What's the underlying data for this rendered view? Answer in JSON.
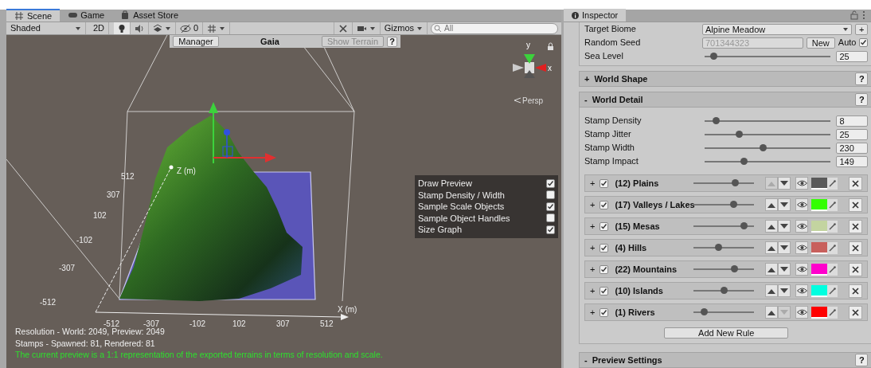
{
  "scene_tabs": [
    {
      "label": "Scene",
      "selected": true
    },
    {
      "label": "Game",
      "selected": false
    },
    {
      "label": "Asset Store",
      "selected": false
    }
  ],
  "scene_toolbar": {
    "shading": "Shaded",
    "mode_2d": "2D",
    "hidden_count": "0",
    "gizmos": "Gizmos",
    "search_placeholder": "All"
  },
  "gaia_bar": {
    "manager": "Manager",
    "title": "Gaia",
    "show_terrain": "Show Terrain",
    "help": "?"
  },
  "orientation_gizmo": {
    "y_label": "y",
    "x_label": "x",
    "projection": "Persp"
  },
  "axes": {
    "z_label": "Z (m)",
    "x_label": "X (m)",
    "z_ticks": [
      "512",
      "307",
      "102",
      "-102",
      "-307",
      "-512"
    ],
    "x_ticks": [
      "-512",
      "-307",
      "-102",
      "102",
      "307",
      "512"
    ]
  },
  "preview_options": [
    {
      "label": "Draw Preview",
      "checked": true
    },
    {
      "label": "Stamp Density / Width",
      "checked": false
    },
    {
      "label": "Sample Scale Objects",
      "checked": true
    },
    {
      "label": "Sample Object Handles",
      "checked": false
    },
    {
      "label": "Size Graph",
      "checked": true
    }
  ],
  "status": {
    "resolution": "Resolution - World: 2049, Preview: 2049",
    "stamps": "Stamps - Spawned: 81, Rendered: 81",
    "note": "The current preview is a 1:1 representation of the exported terrains in terms of resolution and scale."
  },
  "inspector": {
    "title": "Inspector",
    "target_biome": {
      "label": "Target Biome",
      "value": "Alpine Meadow",
      "add": "+"
    },
    "random_seed": {
      "label": "Random Seed",
      "value": "701344323",
      "disabled": true,
      "new": "New",
      "auto": "Auto",
      "auto_checked": true
    },
    "sea_level": {
      "label": "Sea Level",
      "level": 0.07,
      "value": "25"
    },
    "world_shape": {
      "toggle": "+",
      "label": "World Shape",
      "help": "?"
    },
    "world_detail": {
      "toggle": "-",
      "label": "World Detail",
      "help": "?",
      "sliders": [
        {
          "label": "Stamp Density",
          "level": 0.09,
          "value": "8"
        },
        {
          "label": "Stamp Jitter",
          "level": 0.27,
          "value": "25"
        },
        {
          "label": "Stamp Width",
          "level": 0.46,
          "value": "230"
        },
        {
          "label": "Stamp Impact",
          "level": 0.31,
          "value": "149"
        }
      ],
      "rules": [
        {
          "toggle": "+",
          "checked": true,
          "name": "(12) Plains",
          "level": 0.68,
          "up_disabled": true,
          "down_disabled": false,
          "color": "#5a5a5a"
        },
        {
          "toggle": "+",
          "checked": true,
          "name": "(17) Valleys / Lakes",
          "level": 0.65,
          "up_disabled": false,
          "down_disabled": false,
          "color": "#33ff00"
        },
        {
          "toggle": "+",
          "checked": true,
          "name": "(15) Mesas",
          "level": 0.82,
          "up_disabled": false,
          "down_disabled": false,
          "color": "#c3d4a0"
        },
        {
          "toggle": "+",
          "checked": true,
          "name": "(4) Hills",
          "level": 0.4,
          "up_disabled": false,
          "down_disabled": false,
          "color": "#c8605c"
        },
        {
          "toggle": "+",
          "checked": true,
          "name": "(22) Mountains",
          "level": 0.66,
          "up_disabled": false,
          "down_disabled": false,
          "color": "#ff00cc"
        },
        {
          "toggle": "+",
          "checked": true,
          "name": "(10) Islands",
          "level": 0.5,
          "up_disabled": false,
          "down_disabled": false,
          "color": "#00ffe0"
        },
        {
          "toggle": "+",
          "checked": true,
          "name": "(1) Rivers",
          "level": 0.17,
          "up_disabled": false,
          "down_disabled": true,
          "color": "#ff0000"
        }
      ],
      "add_rule": "Add New Rule"
    },
    "preview_settings": {
      "toggle": "-",
      "label": "Preview Settings",
      "help": "?"
    }
  }
}
